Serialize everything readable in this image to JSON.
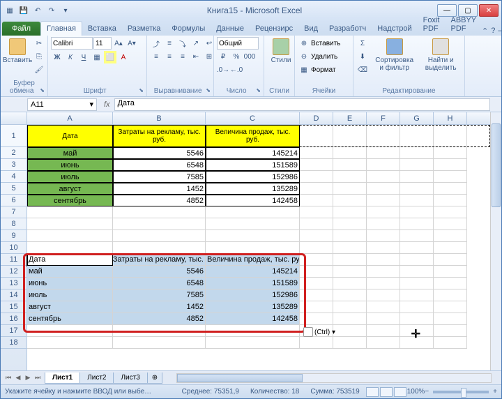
{
  "title": "Книга15 - Microsoft Excel",
  "tabs": {
    "file": "Файл",
    "items": [
      "Главная",
      "Вставка",
      "Разметка",
      "Формулы",
      "Данные",
      "Рецензирс",
      "Вид",
      "Разработч",
      "Надстрой",
      "Foxit PDF",
      "ABBYY PDF"
    ]
  },
  "ribbon": {
    "clipboard": {
      "label": "Буфер обмена",
      "paste": "Вставить"
    },
    "font": {
      "label": "Шрифт",
      "name": "Calibri",
      "size": "11"
    },
    "align": {
      "label": "Выравнивание"
    },
    "number": {
      "label": "Число",
      "format": "Общий"
    },
    "styles": {
      "label": "Стили",
      "btn": "Стили"
    },
    "cells": {
      "label": "Ячейки",
      "insert": "Вставить",
      "delete": "Удалить",
      "format": "Формат"
    },
    "editing": {
      "label": "Редактирование",
      "sort": "Сортировка и фильтр",
      "find": "Найти и выделить"
    }
  },
  "namebox": "A11",
  "formula": "Дата",
  "cols": [
    "A",
    "B",
    "C",
    "D",
    "E",
    "F",
    "G",
    "H"
  ],
  "table1": {
    "headers": [
      "Дата",
      "Затраты на рекламу, тыс. руб.",
      "Величина продаж, тыс. руб."
    ],
    "rows": [
      {
        "m": "май",
        "b": "5546",
        "c": "145214"
      },
      {
        "m": "июнь",
        "b": "6548",
        "c": "151589"
      },
      {
        "m": "июль",
        "b": "7585",
        "c": "152986"
      },
      {
        "m": "август",
        "b": "1452",
        "c": "135289"
      },
      {
        "m": "сентябрь",
        "b": "4852",
        "c": "142458"
      }
    ]
  },
  "table2": {
    "headers": [
      "Дата",
      "Затраты на рекламу, тыс.",
      "Величина продаж, тыс. руб."
    ],
    "rows": [
      {
        "m": "май",
        "b": "5546",
        "c": "145214"
      },
      {
        "m": "июнь",
        "b": "6548",
        "c": "151589"
      },
      {
        "m": "июль",
        "b": "7585",
        "c": "152986"
      },
      {
        "m": "август",
        "b": "1452",
        "c": "135289"
      },
      {
        "m": "сентябрь",
        "b": "4852",
        "c": "142458"
      }
    ]
  },
  "paste_opts": "(Ctrl) ▾",
  "sheets": [
    "Лист1",
    "Лист2",
    "Лист3"
  ],
  "status": {
    "msg": "Укажите ячейку и нажмите ВВОД или выбе…",
    "avg_l": "Среднее:",
    "avg_v": "75351,9",
    "cnt_l": "Количество:",
    "cnt_v": "18",
    "sum_l": "Сумма:",
    "sum_v": "753519",
    "zoom": "100%"
  }
}
